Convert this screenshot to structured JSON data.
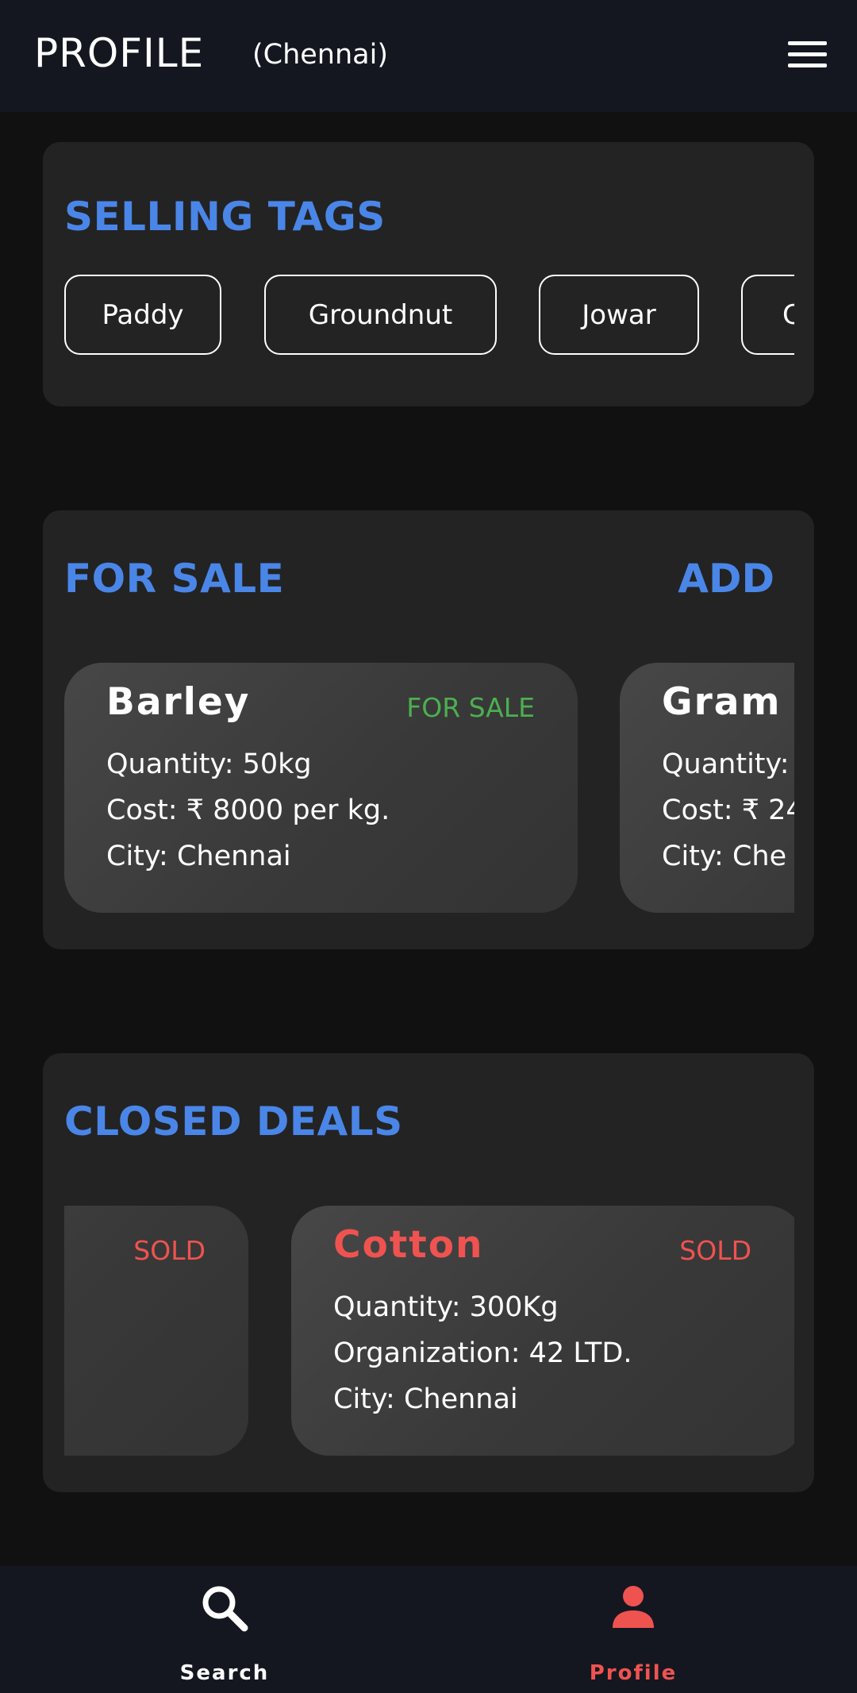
{
  "header": {
    "title": "PROFILE",
    "city": "(Chennai)",
    "menu_icon": "hamburger-menu-icon"
  },
  "selling_tags": {
    "title": "SELLING TAGS",
    "tags": [
      "Paddy",
      "Groundnut",
      "Jowar",
      "C"
    ]
  },
  "for_sale": {
    "title": "FOR SALE",
    "add_label": "ADD",
    "items": [
      {
        "name": "Barley",
        "status": "FOR SALE",
        "quantity": "Quantity:  50kg",
        "cost": "Cost:  ₹ 8000 per kg.",
        "city": "City:  Chennai"
      },
      {
        "name": "Gram",
        "status": "",
        "quantity": "Quantity:",
        "cost": "Cost:  ₹ 24",
        "city": "City:  Che"
      }
    ]
  },
  "closed_deals": {
    "title": "CLOSED DEALS",
    "items": [
      {
        "status": "SOLD"
      },
      {
        "name": "Cotton",
        "status": "SOLD",
        "quantity": "Quantity:  300Kg",
        "organization": "Organization: 42 LTD.",
        "city": "City: Chennai"
      }
    ]
  },
  "bottom_nav": {
    "items": [
      {
        "label": "Search",
        "icon": "search-icon",
        "active": false
      },
      {
        "label": "Profile",
        "icon": "person-icon",
        "active": true
      }
    ]
  },
  "colors": {
    "accent_blue": "#4a86e8",
    "for_sale_green": "#4caf50",
    "sold_red": "#ef5350",
    "nav_active": "#ef5350",
    "background": "#111112",
    "card": "#232323",
    "bar": "#141720"
  }
}
